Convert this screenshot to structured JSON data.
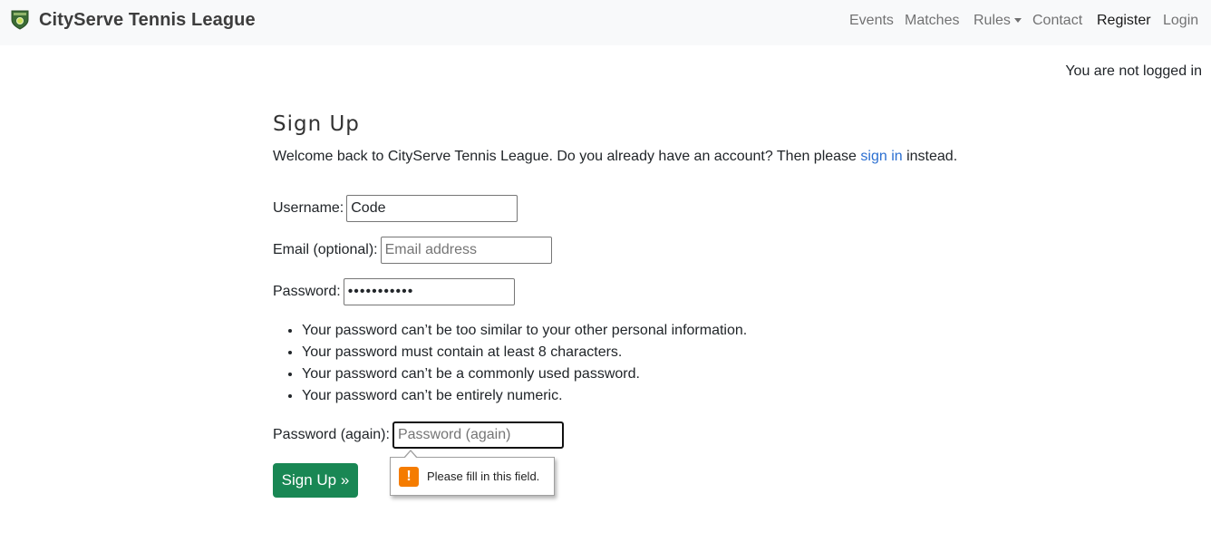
{
  "navbar": {
    "brand": "CityServe Tennis League",
    "brand_logo_icon": "tennis-shield-logo-icon",
    "items": {
      "events": "Events",
      "matches": "Matches",
      "rules": "Rules",
      "contact": "Contact",
      "register": "Register",
      "login": "Login"
    }
  },
  "login_status": "You are not logged in",
  "page": {
    "title": "Sign Up",
    "welcome_prefix": "Welcome back to CityServe Tennis League. Do you already have an account? Then please ",
    "welcome_link": "sign in",
    "welcome_suffix": " instead."
  },
  "form": {
    "username_label": "Username:",
    "username_value": "Code",
    "email_label": "Email (optional):",
    "email_placeholder": "Email address",
    "password_label": "Password:",
    "password_value": "Code1234567",
    "password_rules": [
      "Your password can’t be too similar to your other personal information.",
      "Your password must contain at least 8 characters.",
      "Your password can’t be a commonly used password.",
      "Your password can’t be entirely numeric."
    ],
    "password2_label": "Password (again):",
    "password2_placeholder": "Password (again)",
    "submit_label": "Sign Up »",
    "validation_message": "Please fill in this field.",
    "validation_icon": "warning-icon",
    "validation_icon_glyph": "!"
  },
  "colors": {
    "primary_button": "#198754",
    "link": "#2b6fd1",
    "navbar_bg": "#f8f9fa",
    "warning": "#f57c00"
  }
}
